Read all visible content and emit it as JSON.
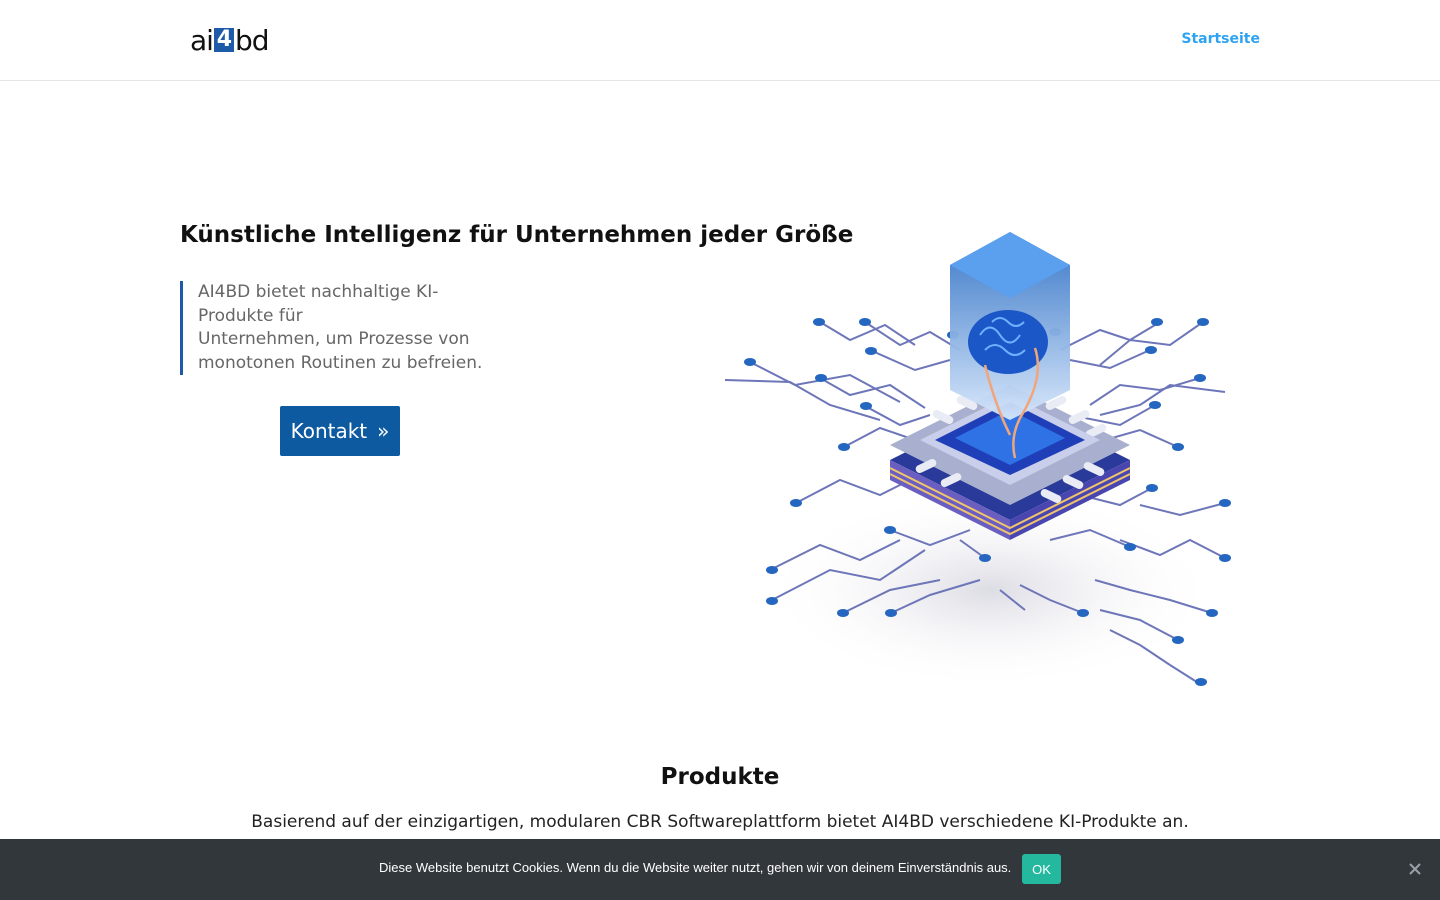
{
  "header": {
    "logo_text_left": "ai",
    "logo_text_mid": "4",
    "logo_text_right": "bd",
    "nav": [
      {
        "label": "Startseite"
      }
    ]
  },
  "hero": {
    "title": "Künstliche Intelligenz für Unternehmen jeder Größe",
    "quote_lines": [
      "AI4BD bietet nachhaltige KI-",
      "Produkte für",
      "Unternehmen, um Prozesse von",
      "monotonen Routinen zu befreien."
    ],
    "button_label": "Kontakt",
    "button_icon": "double-chevron-right-icon"
  },
  "products": {
    "title": "Produkte",
    "text": "Basierend auf der einzigartigen, modularen CBR Softwareplattform bietet AI4BD verschiedene KI-Produkte an."
  },
  "cookie": {
    "text": "Diese Website benutzt Cookies. Wenn du die Website weiter nutzt, gehen wir von deinem Einverständnis aus.",
    "ok_label": "OK",
    "close_icon": "close-icon"
  },
  "colors": {
    "brand_blue": "#1e5aa8",
    "nav_link": "#2ea3f2",
    "button": "#0d5aa0",
    "cookie_bg": "#32373c",
    "cookie_ok": "#24b89e"
  }
}
